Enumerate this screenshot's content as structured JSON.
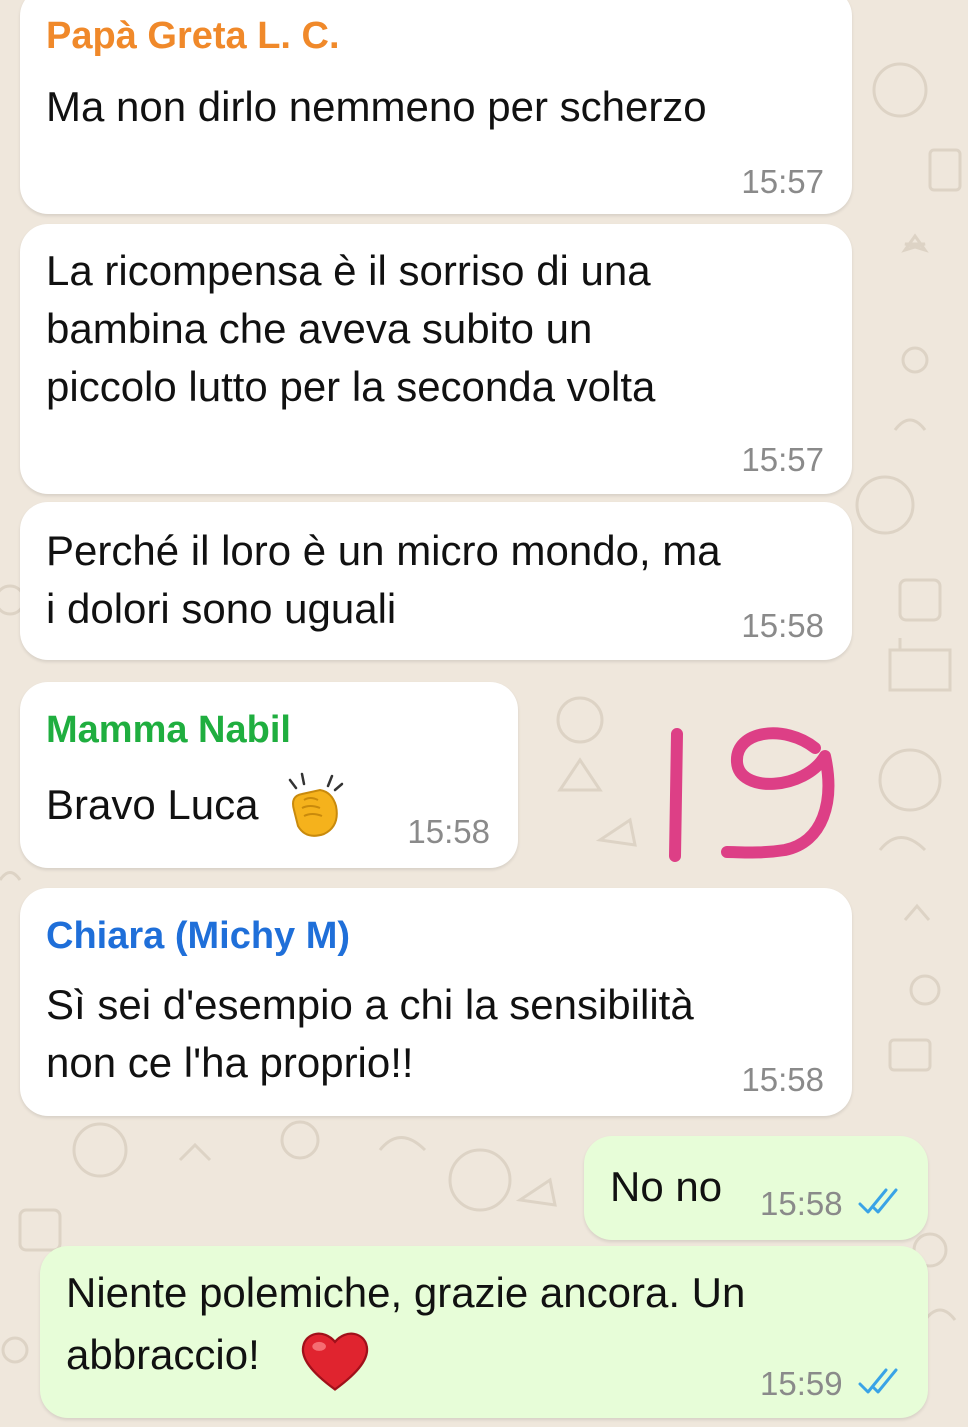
{
  "colors": {
    "wallpaper": "#efe7dc",
    "incoming_bubble": "#ffffff",
    "outgoing_bubble": "#e7fdd8",
    "sender_papa_greta": "#f0892a",
    "sender_mamma_nabil": "#1fae3f",
    "sender_chiara": "#1f6fd9",
    "read_ticks": "#3aa3e6",
    "annotation_ink": "#dd3f86"
  },
  "messages": [
    {
      "direction": "incoming",
      "sender": "Papà Greta L. C.",
      "text": "Ma non dirlo nemmeno per scherzo",
      "time": "15:57"
    },
    {
      "direction": "incoming",
      "sender": "",
      "lines": [
        "La ricompensa è il sorriso di una",
        "bambina che aveva subito un",
        "piccolo lutto per la seconda volta"
      ],
      "time": "15:57"
    },
    {
      "direction": "incoming",
      "sender": "",
      "lines": [
        "Perché il loro è un micro mondo, ma",
        "i dolori sono uguali"
      ],
      "time": "15:58"
    },
    {
      "direction": "incoming",
      "sender": "Mamma Nabil",
      "text": "Bravo Luca",
      "emoji": "clapping-hands",
      "time": "15:58"
    },
    {
      "direction": "incoming",
      "sender": "Chiara (Michy M)",
      "lines": [
        "Sì sei d'esempio a chi la sensibilità",
        "non ce l'ha proprio!!"
      ],
      "time": "15:58"
    },
    {
      "direction": "outgoing",
      "text": "No no",
      "time": "15:58",
      "status": "read"
    },
    {
      "direction": "outgoing",
      "lines": [
        "Niente polemiche, grazie ancora. Un",
        "abbraccio!"
      ],
      "emoji": "red-heart",
      "time": "15:59",
      "status": "read"
    }
  ],
  "annotation": {
    "text": "19"
  }
}
